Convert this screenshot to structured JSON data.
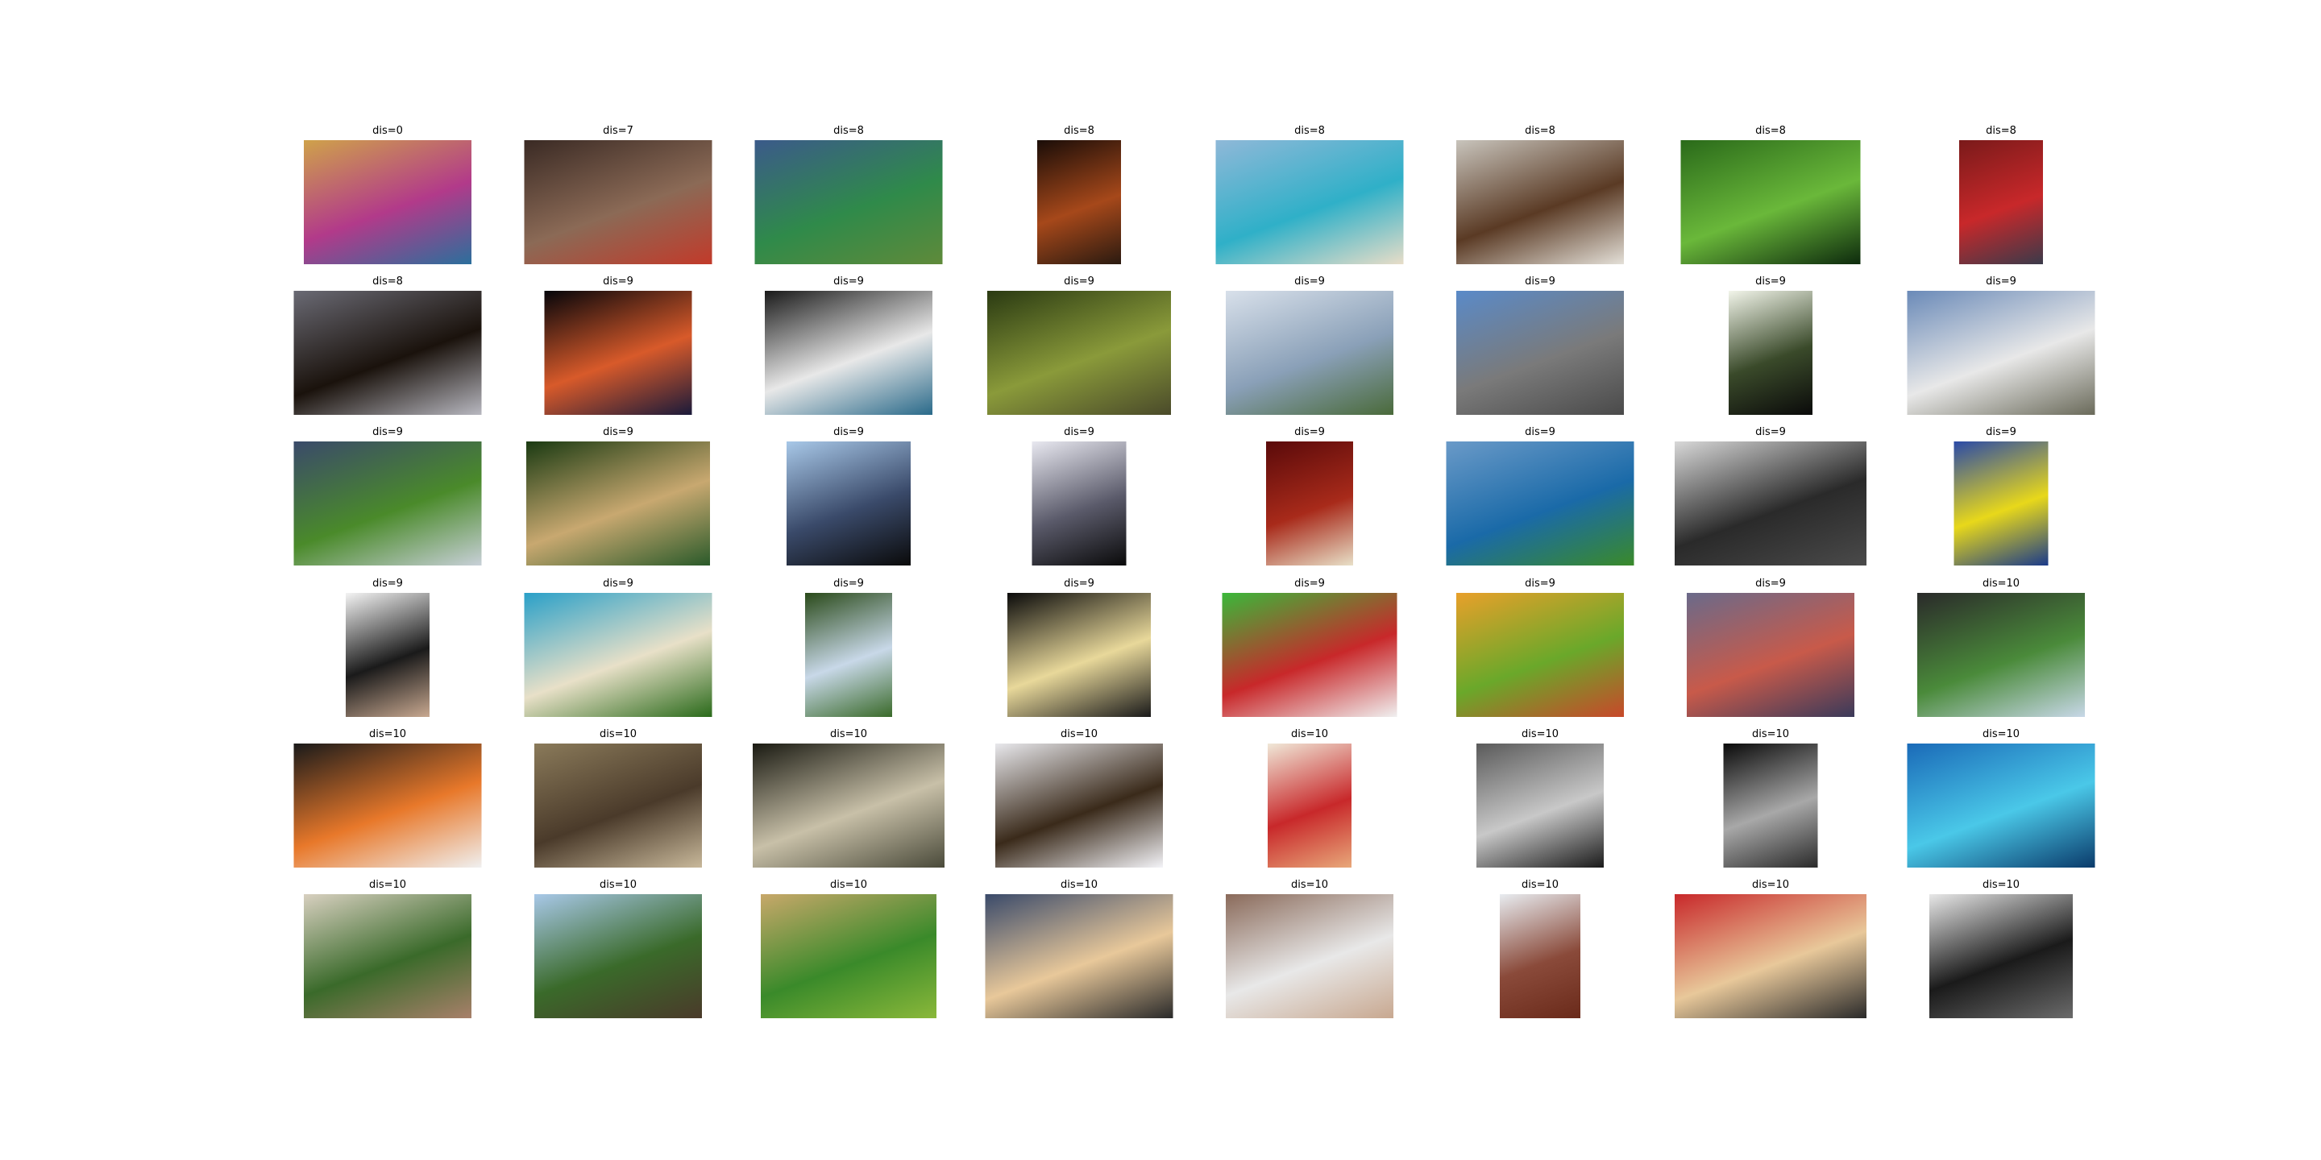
{
  "grid": [
    {
      "label": "dis=0",
      "colors": [
        "#cfa24a",
        "#b23a8a",
        "#2b6f9c"
      ]
    },
    {
      "label": "dis=7",
      "colors": [
        "#3a2a24",
        "#8b6a56",
        "#c23a2a"
      ]
    },
    {
      "label": "dis=8",
      "colors": [
        "#3b5a8a",
        "#2f8a4a",
        "#5f8a3a"
      ]
    },
    {
      "label": "dis=8",
      "colors": [
        "#1a0d08",
        "#a6481a",
        "#2a1a10"
      ]
    },
    {
      "label": "dis=8",
      "colors": [
        "#8fb8d8",
        "#2fb0c8",
        "#e8ddc8"
      ]
    },
    {
      "label": "dis=8",
      "colors": [
        "#c8c4bc",
        "#5a3a24",
        "#e4e0d8"
      ]
    },
    {
      "label": "dis=8",
      "colors": [
        "#2a6a1a",
        "#6ab83a",
        "#0d2a0d"
      ]
    },
    {
      "label": "dis=8",
      "colors": [
        "#7a1a1a",
        "#c8282a",
        "#3a3a4a"
      ]
    },
    {
      "label": "dis=8",
      "colors": [
        "#6a6a74",
        "#1a120c",
        "#b8b8c0"
      ]
    },
    {
      "label": "dis=9",
      "colors": [
        "#05050a",
        "#d85a2a",
        "#1a1a3a"
      ]
    },
    {
      "label": "dis=9",
      "colors": [
        "#1a1a1a",
        "#e8e8e8",
        "#2a6a8a"
      ]
    },
    {
      "label": "dis=9",
      "colors": [
        "#2a3a12",
        "#8a9a3a",
        "#4a4a2a"
      ]
    },
    {
      "label": "dis=9",
      "colors": [
        "#d8e0ea",
        "#8aa0b8",
        "#4a6a3a"
      ]
    },
    {
      "label": "dis=9",
      "colors": [
        "#5a8ac8",
        "#7a7a7a",
        "#4a4a4a"
      ]
    },
    {
      "label": "dis=9",
      "colors": [
        "#f2f5ea",
        "#3a4a2a",
        "#0a0a0a"
      ]
    },
    {
      "label": "dis=9",
      "colors": [
        "#6a8ab8",
        "#e8e8e8",
        "#6a6a5a"
      ]
    },
    {
      "label": "dis=9",
      "colors": [
        "#3a4a6a",
        "#4a8a2a",
        "#c8d0d8"
      ]
    },
    {
      "label": "dis=9",
      "colors": [
        "#1a3a12",
        "#c8a870",
        "#2a5a2a"
      ]
    },
    {
      "label": "dis=9",
      "colors": [
        "#a8c8e8",
        "#3a4a6a",
        "#0a0a0a"
      ]
    },
    {
      "label": "dis=9",
      "colors": [
        "#e8e8f0",
        "#5a5a6a",
        "#0a0a0a"
      ]
    },
    {
      "label": "dis=9",
      "colors": [
        "#5a0a0a",
        "#a82a1a",
        "#e8e0c8"
      ]
    },
    {
      "label": "dis=9",
      "colors": [
        "#6a9ac8",
        "#1a6aa8",
        "#3a8a2a"
      ]
    },
    {
      "label": "dis=9",
      "colors": [
        "#d8d8d8",
        "#2a2a2a",
        "#4a4a4a"
      ]
    },
    {
      "label": "dis=9",
      "colors": [
        "#2a4aa8",
        "#e8d81a",
        "#1a3a8a"
      ]
    },
    {
      "label": "dis=9",
      "colors": [
        "#f4f4f4",
        "#1a1a1a",
        "#c8a890"
      ]
    },
    {
      "label": "dis=9",
      "colors": [
        "#2aa0c8",
        "#e8e0c8",
        "#2a6a1a"
      ]
    },
    {
      "label": "dis=9",
      "colors": [
        "#2a4a1a",
        "#c8d8e8",
        "#3a6a2a"
      ]
    },
    {
      "label": "dis=9",
      "colors": [
        "#0a0a0a",
        "#e8d89a",
        "#1a1a1a"
      ]
    },
    {
      "label": "dis=9",
      "colors": [
        "#3ab83a",
        "#c8282a",
        "#f0f0f0"
      ]
    },
    {
      "label": "dis=9",
      "colors": [
        "#e8a02a",
        "#6aa82a",
        "#c8482a"
      ]
    },
    {
      "label": "dis=9",
      "colors": [
        "#6a6a8a",
        "#c85a4a",
        "#3a3a5a"
      ]
    },
    {
      "label": "dis=10",
      "colors": [
        "#2a2a2a",
        "#4a8a3a",
        "#c8d8e8"
      ]
    },
    {
      "label": "dis=10",
      "colors": [
        "#1a1a1a",
        "#e8782a",
        "#f0f0f0"
      ]
    },
    {
      "label": "dis=10",
      "colors": [
        "#8a7a5a",
        "#4a3a2a",
        "#c8b89a"
      ]
    },
    {
      "label": "dis=10",
      "colors": [
        "#1a1a12",
        "#c8c0a8",
        "#4a4a3a"
      ]
    },
    {
      "label": "dis=10",
      "colors": [
        "#e8e8ec",
        "#3a2a1a",
        "#f4f4f8"
      ]
    },
    {
      "label": "dis=10",
      "colors": [
        "#f0e8d8",
        "#c8282a",
        "#e8a87a"
      ]
    },
    {
      "label": "dis=10",
      "colors": [
        "#5a5a5a",
        "#c8c8c8",
        "#1a1a1a"
      ]
    },
    {
      "label": "dis=10",
      "colors": [
        "#0a0a0a",
        "#a8a8a8",
        "#2a2a2a"
      ]
    },
    {
      "label": "dis=10",
      "colors": [
        "#1a6ab8",
        "#4ac8e8",
        "#0a3a6a"
      ]
    },
    {
      "label": "dis=10",
      "colors": [
        "#d8d0c0",
        "#3a6a2a",
        "#a8806a"
      ]
    },
    {
      "label": "dis=10",
      "colors": [
        "#a8c8e8",
        "#3a6a2a",
        "#4a3a2a"
      ]
    },
    {
      "label": "dis=10",
      "colors": [
        "#c8a86a",
        "#3a8a2a",
        "#8ab83a"
      ]
    },
    {
      "label": "dis=10",
      "colors": [
        "#3a4a6a",
        "#e8c89a",
        "#2a2a2a"
      ]
    },
    {
      "label": "dis=10",
      "colors": [
        "#8a6a5a",
        "#e8e8e8",
        "#c8a890"
      ]
    },
    {
      "label": "dis=10",
      "colors": [
        "#e8ecf0",
        "#8a4a3a",
        "#6a2a1a"
      ]
    },
    {
      "label": "dis=10",
      "colors": [
        "#c8282a",
        "#e8c89a",
        "#2a2a2a"
      ]
    },
    {
      "label": "dis=10",
      "colors": [
        "#e8e8e8",
        "#1a1a1a",
        "#6a6a6a"
      ]
    }
  ]
}
